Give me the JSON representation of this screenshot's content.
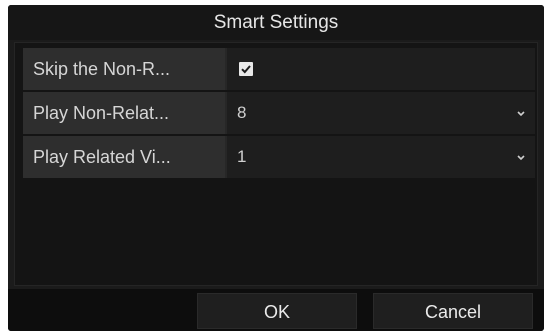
{
  "dialog": {
    "title": "Smart Settings"
  },
  "settings": {
    "rows": [
      {
        "label": "Skip the Non-R...",
        "type": "checkbox",
        "checked": true
      },
      {
        "label": "Play Non-Relat...",
        "type": "select",
        "value": "8"
      },
      {
        "label": "Play Related Vi...",
        "type": "select",
        "value": "1"
      }
    ]
  },
  "footer": {
    "ok_label": "OK",
    "cancel_label": "Cancel"
  },
  "icons": {
    "checkbox": "checkmark-icon",
    "dropdown": "chevron-down-icon"
  }
}
